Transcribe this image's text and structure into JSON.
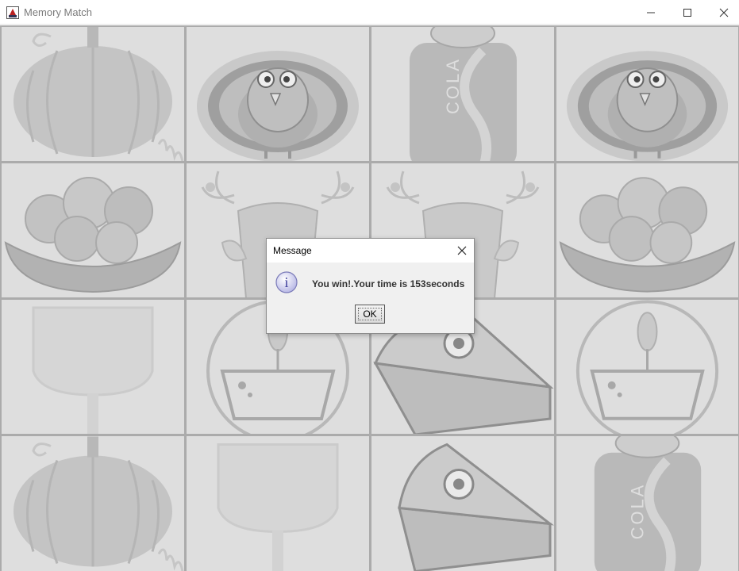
{
  "window": {
    "title": "Memory Match"
  },
  "board": {
    "cards": [
      {
        "icon": "pumpkin-icon"
      },
      {
        "icon": "turkey-icon"
      },
      {
        "icon": "cola-can-icon"
      },
      {
        "icon": "turkey-icon"
      },
      {
        "icon": "bread-basket-icon"
      },
      {
        "icon": "floral-pot-icon"
      },
      {
        "icon": "floral-pot-icon"
      },
      {
        "icon": "bread-basket-icon"
      },
      {
        "icon": "wine-glass-icon"
      },
      {
        "icon": "candle-bowl-icon"
      },
      {
        "icon": "pie-slice-icon"
      },
      {
        "icon": "candle-bowl-icon"
      },
      {
        "icon": "pumpkin-icon"
      },
      {
        "icon": "wine-glass-icon"
      },
      {
        "icon": "pie-slice-icon"
      },
      {
        "icon": "cola-can-icon"
      }
    ],
    "can_text": "COLA"
  },
  "dialog": {
    "title": "Message",
    "message": "You win!.Your time is 153seconds",
    "ok_label": "OK",
    "info_glyph": "i"
  }
}
